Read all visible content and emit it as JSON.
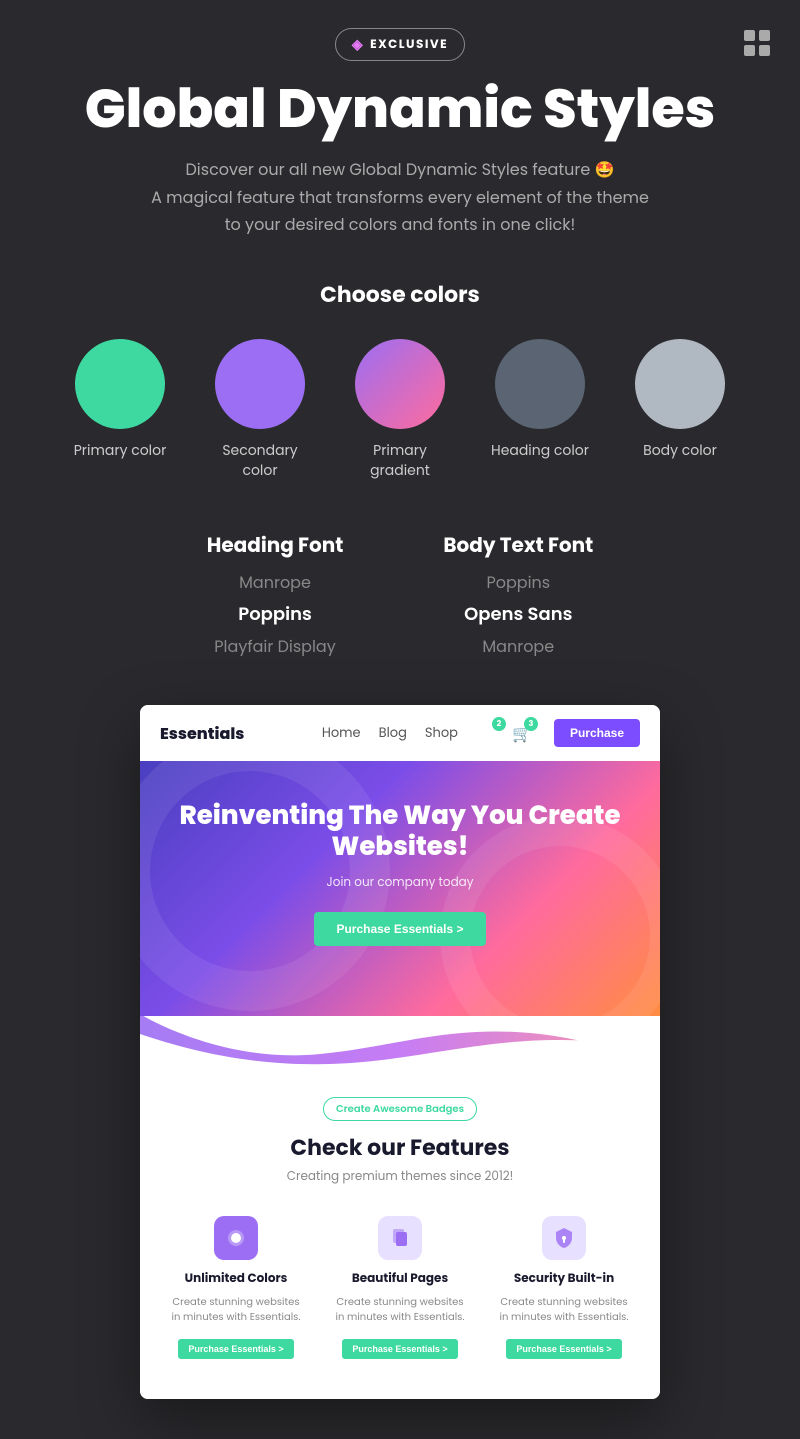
{
  "topbar": {
    "exclusive_label": "EXCLUSIVE",
    "logo_alt": "Themeforest logo"
  },
  "hero": {
    "title": "Global Dynamic Styles",
    "subtitle_line1": "Discover our all new Global Dynamic Styles feature 🤩",
    "subtitle_line2": "A magical feature that transforms every element of the theme",
    "subtitle_line3": "to your desired colors and fonts in one click!"
  },
  "colors": {
    "section_title": "Choose colors",
    "items": [
      {
        "label": "Primary color",
        "circle_class": "circle-primary"
      },
      {
        "label": "Secondary color",
        "circle_class": "circle-secondary"
      },
      {
        "label": "Primary gradient",
        "circle_class": "circle-gradient"
      },
      {
        "label": "Heading color",
        "circle_class": "circle-heading"
      },
      {
        "label": "Body color",
        "circle_class": "circle-body"
      }
    ]
  },
  "fonts": {
    "heading": {
      "title": "Heading Font",
      "options": [
        {
          "name": "Manrope",
          "active": false
        },
        {
          "name": "Poppins",
          "active": true
        },
        {
          "name": "Playfair Display",
          "active": false
        }
      ]
    },
    "body": {
      "title": "Body Text Font",
      "options": [
        {
          "name": "Poppins",
          "active": false
        },
        {
          "name": "Opens Sans",
          "active": true
        },
        {
          "name": "Manrope",
          "active": false
        }
      ]
    }
  },
  "preview": {
    "nav": {
      "logo": "Essentials",
      "links": [
        "Home",
        "Blog",
        "Shop"
      ],
      "wishlist_count": "2",
      "cart_count": "3",
      "purchase_btn": "Purchase"
    },
    "hero": {
      "title": "Reinventing The Way You Create Websites!",
      "subtitle": "Join our company today",
      "cta_btn": "Purchase Essentials >"
    },
    "features": {
      "badge": "Create Awesome Badges",
      "title": "Check our Features",
      "subtitle": "Creating premium themes since 2012!",
      "cards": [
        {
          "title": "Unlimited Colors",
          "text": "Create stunning websites in minutes with Essentials.",
          "btn": "Purchase Essentials >"
        },
        {
          "title": "Beautiful Pages",
          "text": "Create stunning websites in minutes with Essentials.",
          "btn": "Purchase Essentials >"
        },
        {
          "title": "Security Built-in",
          "text": "Create stunning websites in minutes with Essentials.",
          "btn": "Purchase Essentials >"
        }
      ]
    }
  }
}
